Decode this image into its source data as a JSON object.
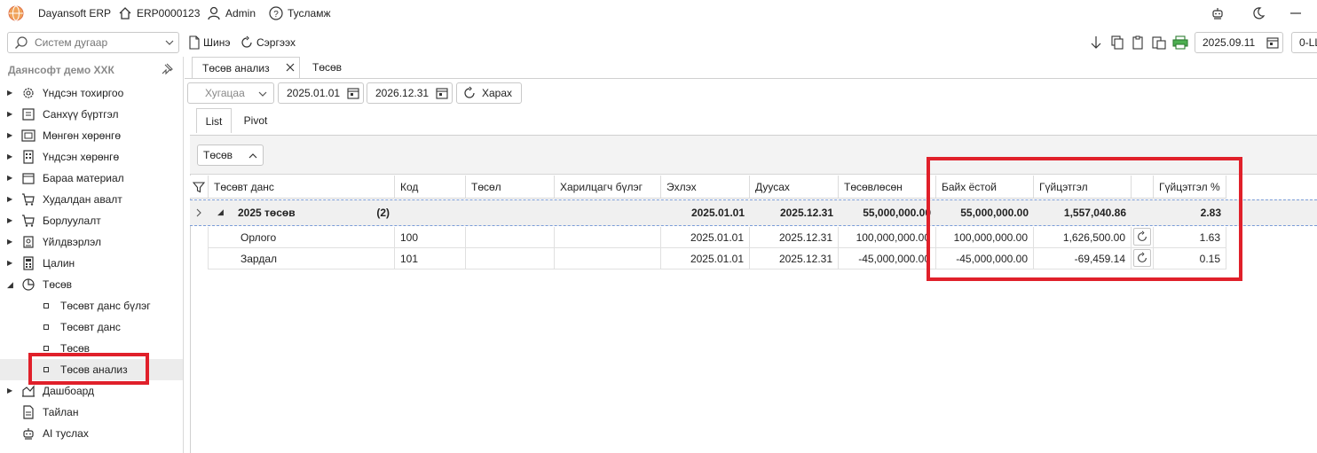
{
  "app": {
    "title": "Dayansoft ERP",
    "company_code": "ERP0000123",
    "user": "Admin",
    "help_label": "Тусламж"
  },
  "toolbar": {
    "search_placeholder": "Систем дугаар",
    "new_label": "Шинэ",
    "refresh_label": "Сэргээх",
    "date": "2025.09.11",
    "right_field": "0-LL"
  },
  "sidebar": {
    "company": "Даянсофт демо ХХК",
    "items": [
      {
        "label": "Үндсэн тохиргоо",
        "icon": "gear-icon"
      },
      {
        "label": "Санхүү бүртгэл",
        "icon": "ledger-icon"
      },
      {
        "label": "Мөнгөн хөрөнгө",
        "icon": "cash-icon"
      },
      {
        "label": "Үндсэн хөрөнгө",
        "icon": "building-icon"
      },
      {
        "label": "Бараа материал",
        "icon": "box-icon"
      },
      {
        "label": "Худалдан авалт",
        "icon": "cart-icon"
      },
      {
        "label": "Борлуулалт",
        "icon": "sales-cart-icon"
      },
      {
        "label": "Үйлдвэрлэл",
        "icon": "factory-icon"
      },
      {
        "label": "Цалин",
        "icon": "calculator-icon"
      },
      {
        "label": "Төсөв",
        "icon": "pie-chart-icon"
      }
    ],
    "budget_children": [
      "Төсөвт данс бүлэг",
      "Төсөвт данс",
      "Төсөв",
      "Төсөв анализ"
    ],
    "bottom_items": [
      {
        "label": "Дашбоард",
        "icon": "dashboard-icon"
      },
      {
        "label": "Тайлан",
        "icon": "report-icon"
      },
      {
        "label": "AI туслах",
        "icon": "robot-icon"
      }
    ]
  },
  "tabs": [
    {
      "label": "Төсөв анализ",
      "active": true
    },
    {
      "label": "Төсөв",
      "active": false
    }
  ],
  "filters": {
    "period_placeholder": "Хугацаа",
    "start_date": "2025.01.01",
    "end_date": "2026.12.31",
    "view_button": "Харах"
  },
  "view_tabs": [
    "List",
    "Pivot"
  ],
  "group_chip": "Төсөв",
  "grid": {
    "columns": [
      "Төсөвт данс",
      "Код",
      "Төсөл",
      "Харилцагч бүлэг",
      "Эхлэх",
      "Дуусах",
      "Төсөвлөсөн",
      "Байх ёстой",
      "Гүйцэтгэл",
      "",
      "Гүйцэтгэл %"
    ],
    "group_row": {
      "label": "2025 төсөв",
      "count": "(2)",
      "start": "2025.01.01",
      "end": "2025.12.31",
      "planned": "55,000,000.00",
      "expected": "55,000,000.00",
      "actual": "1,557,040.86",
      "percent": "2.83"
    },
    "rows": [
      {
        "name": "Орлого",
        "code": "100",
        "project": "",
        "partner_group": "",
        "start": "2025.01.01",
        "end": "2025.12.31",
        "planned": "100,000,000.00",
        "expected": "100,000,000.00",
        "actual": "1,626,500.00",
        "percent": "1.63"
      },
      {
        "name": "Зардал",
        "code": "101",
        "project": "",
        "partner_group": "",
        "start": "2025.01.01",
        "end": "2025.12.31",
        "planned": "-45,000,000.00",
        "expected": "-45,000,000.00",
        "actual": "-69,459.14",
        "percent": "0.15"
      }
    ]
  },
  "colors": {
    "highlight": "#e0202a",
    "group_row_bg": "#f0f0f0"
  }
}
